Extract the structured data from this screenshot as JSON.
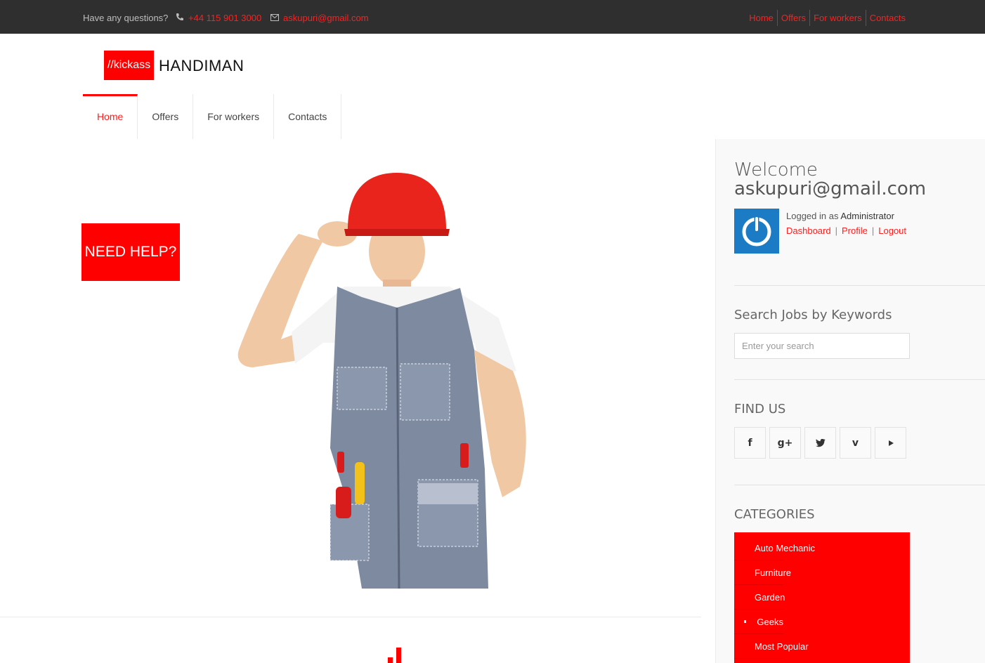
{
  "topbar": {
    "question": "Have any questions?",
    "phone": "+44 115 901 3000",
    "email": "askupuri@gmail.com",
    "nav": [
      "Home",
      "Offers",
      "For workers",
      "Contacts"
    ]
  },
  "logo": {
    "badge": "//kickass",
    "name": "HANDIMAN"
  },
  "mainnav": {
    "items": [
      "Home",
      "Offers",
      "For workers",
      "Contacts"
    ],
    "active": "Home"
  },
  "hero": {
    "cta": "NEED HELP?"
  },
  "sidebar": {
    "welcome_line1": "Welcome",
    "welcome_line2": "askupuri@gmail.com",
    "logged_prefix": "Logged in as",
    "logged_role": "Administrator",
    "links": [
      "Dashboard",
      "Profile",
      "Logout"
    ],
    "search_title": "Search Jobs by Keywords",
    "search_placeholder": "Enter your search",
    "find_title": "FIND US",
    "socials": [
      "facebook-icon",
      "google-plus-icon",
      "twitter-icon",
      "vimeo-icon",
      "youtube-icon"
    ],
    "categories_title": "CATEGORIES",
    "categories": [
      "Auto Mechanic",
      "Furniture",
      "Garden",
      "Geeks",
      "Most Popular"
    ]
  },
  "colors": {
    "accent": "#ff0000",
    "topbar": "#2f2f2f",
    "avatar": "#1b7bc4"
  }
}
